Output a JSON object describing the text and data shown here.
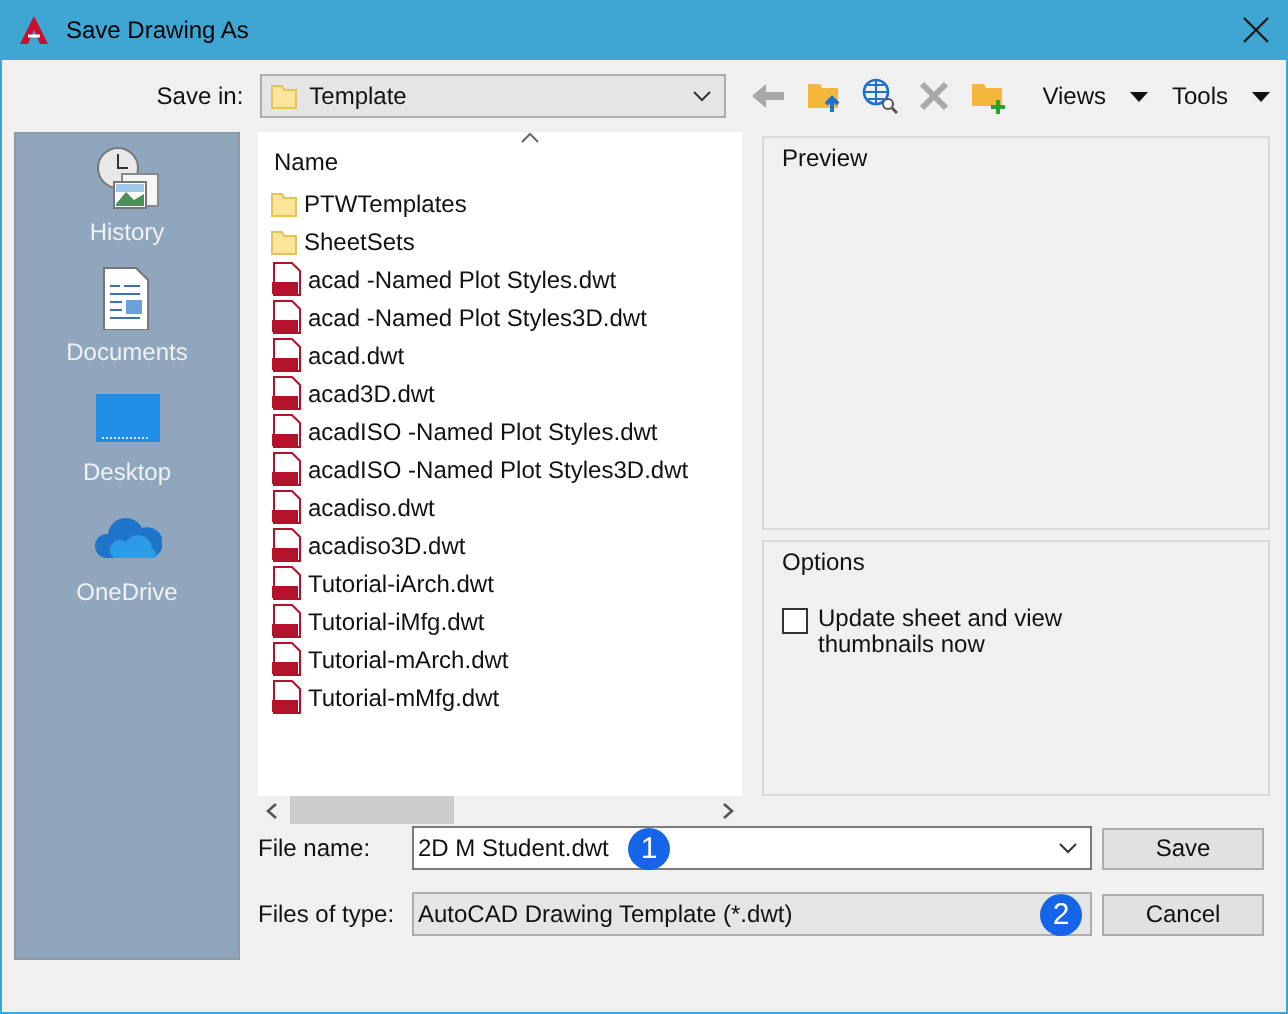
{
  "window": {
    "title": "Save Drawing As"
  },
  "toolbar": {
    "save_in_label": "Save in:",
    "save_in_value": "Template",
    "menus": [
      {
        "label": "Views"
      },
      {
        "label": "Tools"
      }
    ]
  },
  "places": [
    {
      "label": "History",
      "kind": "history"
    },
    {
      "label": "Documents",
      "kind": "documents"
    },
    {
      "label": "Desktop",
      "kind": "desktop"
    },
    {
      "label": "OneDrive",
      "kind": "cloud"
    }
  ],
  "file_list": {
    "column": "Name",
    "items": [
      {
        "name": "PTWTemplates",
        "kind": "folder"
      },
      {
        "name": "SheetSets",
        "kind": "folder"
      },
      {
        "name": "acad -Named Plot Styles.dwt",
        "kind": "dwt"
      },
      {
        "name": "acad -Named Plot Styles3D.dwt",
        "kind": "dwt"
      },
      {
        "name": "acad.dwt",
        "kind": "dwt"
      },
      {
        "name": "acad3D.dwt",
        "kind": "dwt"
      },
      {
        "name": "acadISO -Named Plot Styles.dwt",
        "kind": "dwt"
      },
      {
        "name": "acadISO -Named Plot Styles3D.dwt",
        "kind": "dwt"
      },
      {
        "name": "acadiso.dwt",
        "kind": "dwt"
      },
      {
        "name": "acadiso3D.dwt",
        "kind": "dwt"
      },
      {
        "name": "Tutorial-iArch.dwt",
        "kind": "dwt"
      },
      {
        "name": "Tutorial-iMfg.dwt",
        "kind": "dwt"
      },
      {
        "name": "Tutorial-mArch.dwt",
        "kind": "dwt"
      },
      {
        "name": "Tutorial-mMfg.dwt",
        "kind": "dwt"
      }
    ]
  },
  "preview": {
    "title": "Preview"
  },
  "options": {
    "title": "Options",
    "checkbox": {
      "label": "Update sheet and view thumbnails now",
      "checked": false
    }
  },
  "file_name": {
    "label": "File name:",
    "value": "2D M Student.dwt",
    "marker": "1"
  },
  "file_type": {
    "label": "Files of type:",
    "value": "AutoCAD Drawing Template (*.dwt)",
    "marker": "2"
  },
  "buttons": [
    {
      "label": "Save"
    },
    {
      "label": "Cancel"
    }
  ]
}
